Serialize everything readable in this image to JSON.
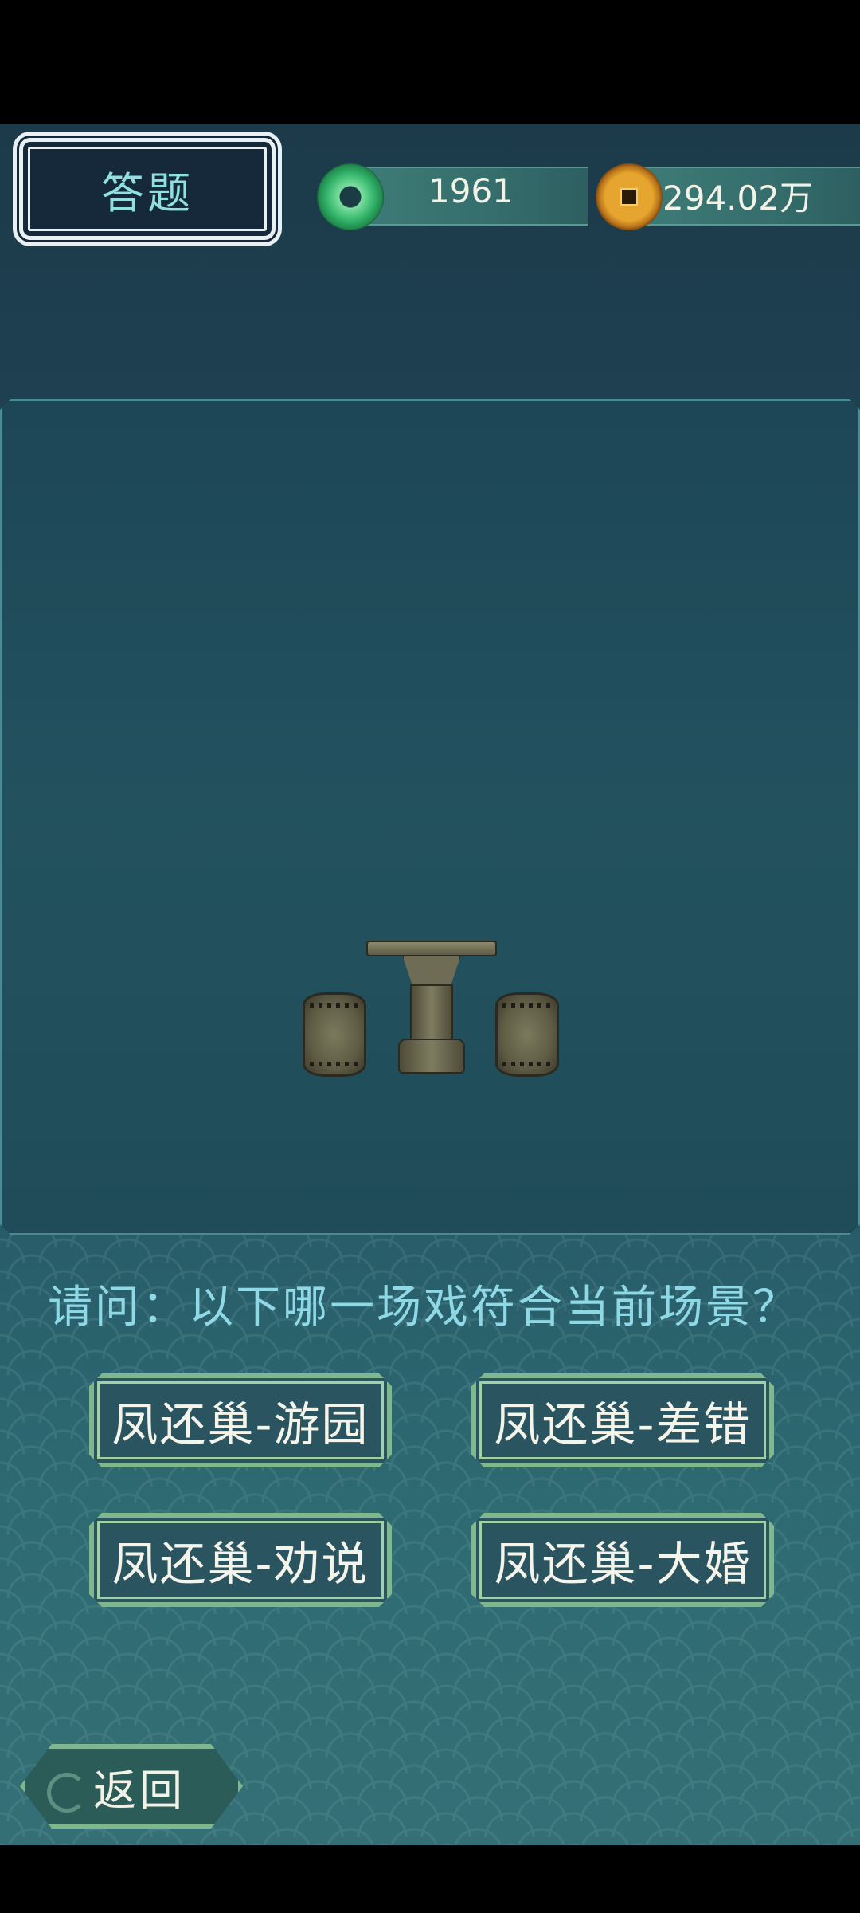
{
  "header": {
    "title": "答题",
    "jade_count": "1961",
    "coin_count": "294.02万"
  },
  "question": {
    "text": "请问：以下哪一场戏符合当前场景？"
  },
  "answers": [
    {
      "label": "凤还巢-游园"
    },
    {
      "label": "凤还巢-差错"
    },
    {
      "label": "凤还巢-劝说"
    },
    {
      "label": "凤还巢-大婚"
    }
  ],
  "footer": {
    "back_label": "返回"
  },
  "icons": {
    "jade": "jade-ring-icon",
    "coin": "copper-coin-icon"
  },
  "colors": {
    "question_text": "#8fd8e6",
    "button_border": "#7fb88c",
    "title_text": "#8fe0e0"
  }
}
